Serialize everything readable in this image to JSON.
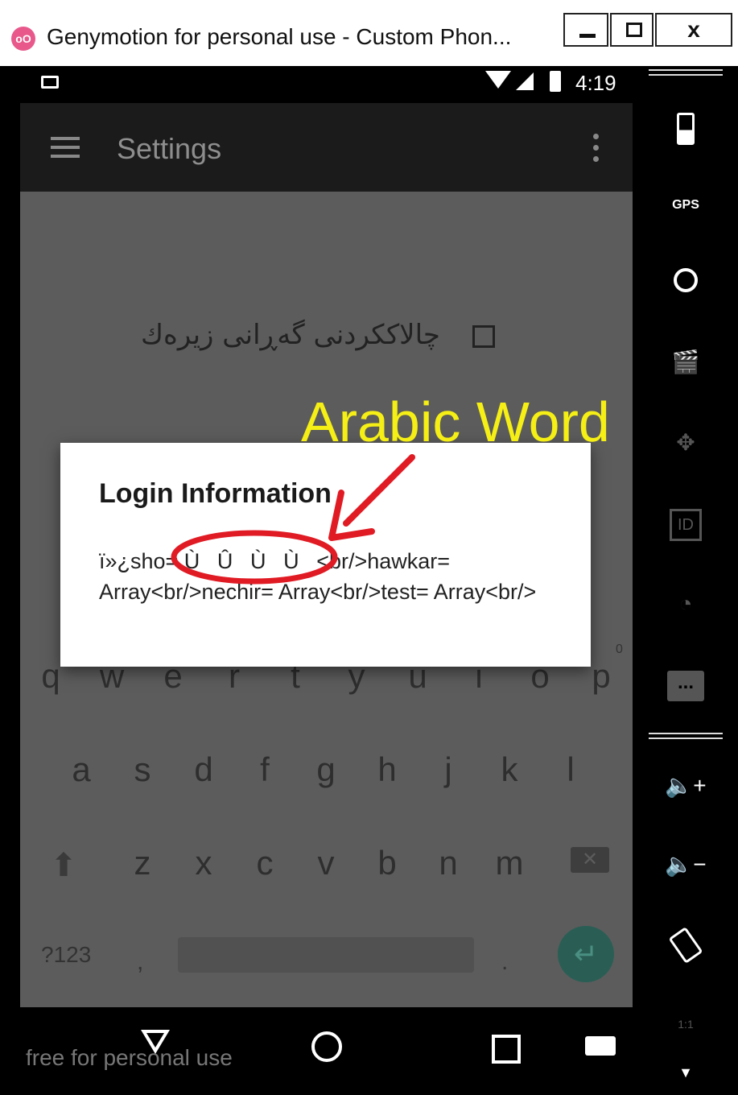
{
  "window": {
    "logo": "oO",
    "title": "Genymotion for personal use - Custom Phon...",
    "minimize": "",
    "maximize": "",
    "close": "x"
  },
  "status_bar": {
    "time": "4:19"
  },
  "app_bar": {
    "title": "Settings"
  },
  "preference": {
    "label": "چالاککردنی گەڕانی زیرەك",
    "checked": false
  },
  "dialog": {
    "title": "Login Information",
    "message": "ï»¿sho= ÙÛÙÙ<br/>hawkar= Array<br/>nechir= Array<br/>test= Array<br/>"
  },
  "annotation": {
    "label": "Arabic Word",
    "color": "#f5ef15",
    "circle_color": "#e01b24"
  },
  "keyboard": {
    "row1": [
      "q",
      "w",
      "e",
      "r",
      "t",
      "y",
      "u",
      "i",
      "o",
      "p"
    ],
    "row2": [
      "a",
      "s",
      "d",
      "f",
      "g",
      "h",
      "j",
      "k",
      "l"
    ],
    "row3": [
      "z",
      "x",
      "c",
      "v",
      "b",
      "n",
      "m"
    ],
    "symbols_key": "?123",
    "comma_key": ",",
    "period_key": ".",
    "zero_hint": "0"
  },
  "footer": {
    "watermark": "free for personal use"
  },
  "sidebar": {
    "gps_label": "GPS",
    "id_label": "ID",
    "sms_label": "...",
    "zoom_label": "1:1"
  }
}
